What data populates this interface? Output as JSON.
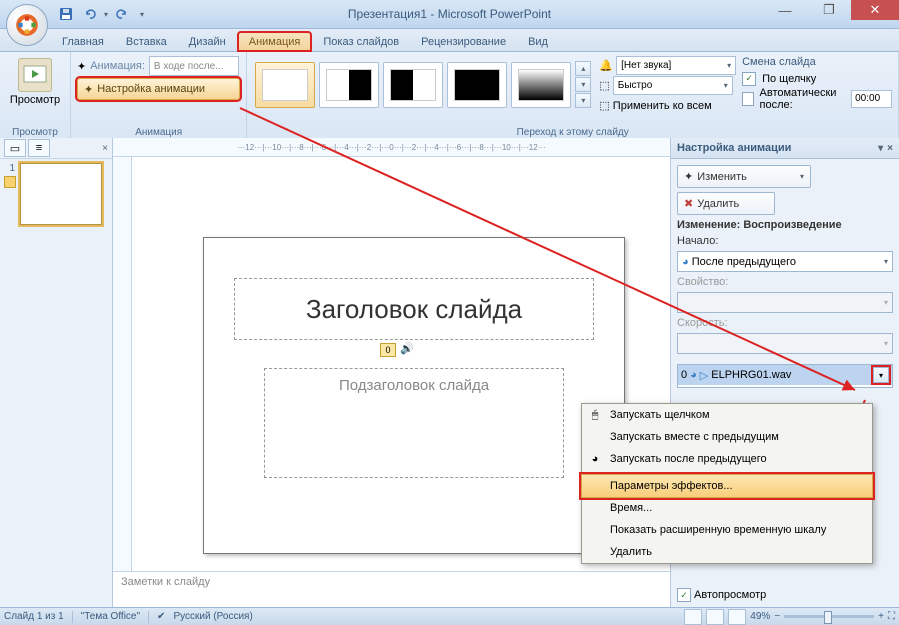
{
  "title": "Презентация1 - Microsoft PowerPoint",
  "tabs": [
    "Главная",
    "Вставка",
    "Дизайн",
    "Анимация",
    "Показ слайдов",
    "Рецензирование",
    "Вид"
  ],
  "active_tab_index": 3,
  "ribbon": {
    "preview_group": "Просмотр",
    "preview_btn": "Просмотр",
    "anim_group": "Анимация",
    "anim_label": "Анимация:",
    "anim_value": "В ходе после...",
    "config_btn": "Настройка анимации",
    "trans_group": "Переход к этому слайду",
    "sound_value": "[Нет звука]",
    "speed_value": "Быстро",
    "apply_all": "Применить ко всем",
    "change_header": "Смена слайда",
    "on_click": "По щелчку",
    "auto_after": "Автоматически после:",
    "auto_time": "00:00"
  },
  "slide": {
    "title_ph": "Заголовок слайда",
    "subtitle_ph": "Подзаголовок слайда",
    "seq": "0"
  },
  "notes_ph": "Заметки к слайду",
  "taskpane": {
    "title": "Настройка анимации",
    "change_btn": "Изменить",
    "remove_btn": "Удалить",
    "modify_header": "Изменение: Воспроизведение",
    "start_lbl": "Начало:",
    "start_val": "После предыдущего",
    "prop_lbl": "Свойство:",
    "speed_lbl": "Скорость:",
    "list_item": "ELPHRG01.wav",
    "list_num": "0",
    "autoview": "Автопросмотр"
  },
  "context_menu": {
    "items": [
      "Запускать щелчком",
      "Запускать вместе с предыдущим",
      "Запускать после предыдущего",
      "Параметры эффектов...",
      "Время...",
      "Показать расширенную временную шкалу",
      "Удалить"
    ],
    "highlighted_index": 3
  },
  "status": {
    "slide": "Слайд 1 из 1",
    "theme": "\"Тема Office\"",
    "lang": "Русский (Россия)",
    "zoom": "49%"
  }
}
